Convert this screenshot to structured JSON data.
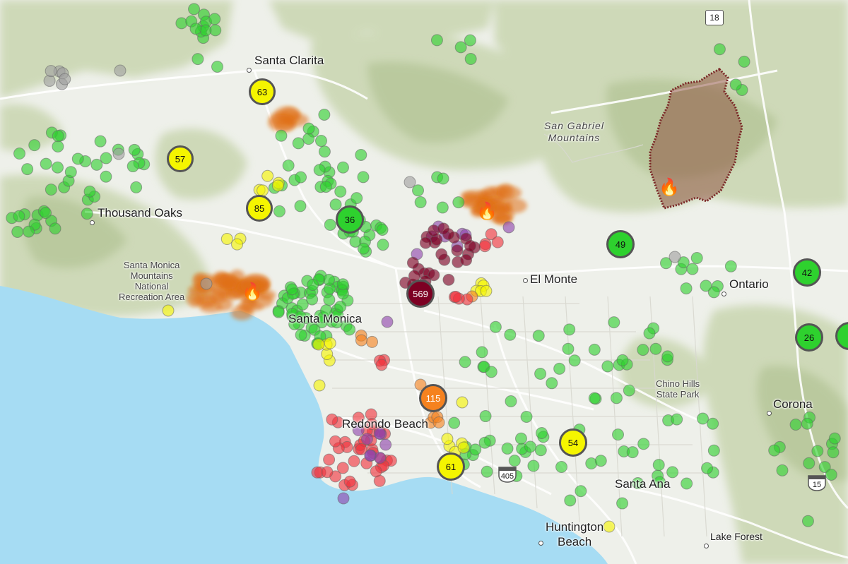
{
  "map": {
    "colors": {
      "land": "#eef0ea",
      "water": "#a6dcf3",
      "terrain": "#c9d6b0",
      "green": "#2ed12e",
      "yellow": "#f5f500",
      "orange": "#f5821f",
      "red": "#f0323c",
      "purple": "#8e44ad",
      "maroon": "#7d0023",
      "gray": "#a0a0a0",
      "smoke": "#e06d1a",
      "burn_area": "#8b4a3a"
    },
    "cities": [
      {
        "name": "Santa Clarita"
      },
      {
        "name": "Thousand Oaks"
      },
      {
        "name": "El Monte"
      },
      {
        "name": "Ontario"
      },
      {
        "name": "Santa Monica"
      },
      {
        "name": "Redondo Beach"
      },
      {
        "name": "Corona"
      },
      {
        "name": "Santa Ana"
      },
      {
        "name": "Huntington\nBeach"
      },
      {
        "name": "Lake Forest"
      }
    ],
    "regions": {
      "mountains": "San Gabriel\nMountains",
      "santa_monica_mtns": "Santa Monica\nMountains\nNational\nRecreation Area",
      "chino_hills": "Chino Hills\nState Park"
    },
    "highway_labels": {
      "route_18": "18",
      "i405": "405",
      "i15": "15"
    },
    "clusters": [
      {
        "value": "63",
        "level": "yellow"
      },
      {
        "value": "57",
        "level": "yellow"
      },
      {
        "value": "85",
        "level": "yellow"
      },
      {
        "value": "36",
        "level": "green"
      },
      {
        "value": "569",
        "level": "maroon"
      },
      {
        "value": "49",
        "level": "green"
      },
      {
        "value": "42",
        "level": "green"
      },
      {
        "value": "26",
        "level": "green"
      },
      {
        "value": "115",
        "level": "orange"
      },
      {
        "value": "54",
        "level": "yellow"
      },
      {
        "value": "61",
        "level": "yellow"
      }
    ],
    "fire_icon": "fire-icon"
  }
}
